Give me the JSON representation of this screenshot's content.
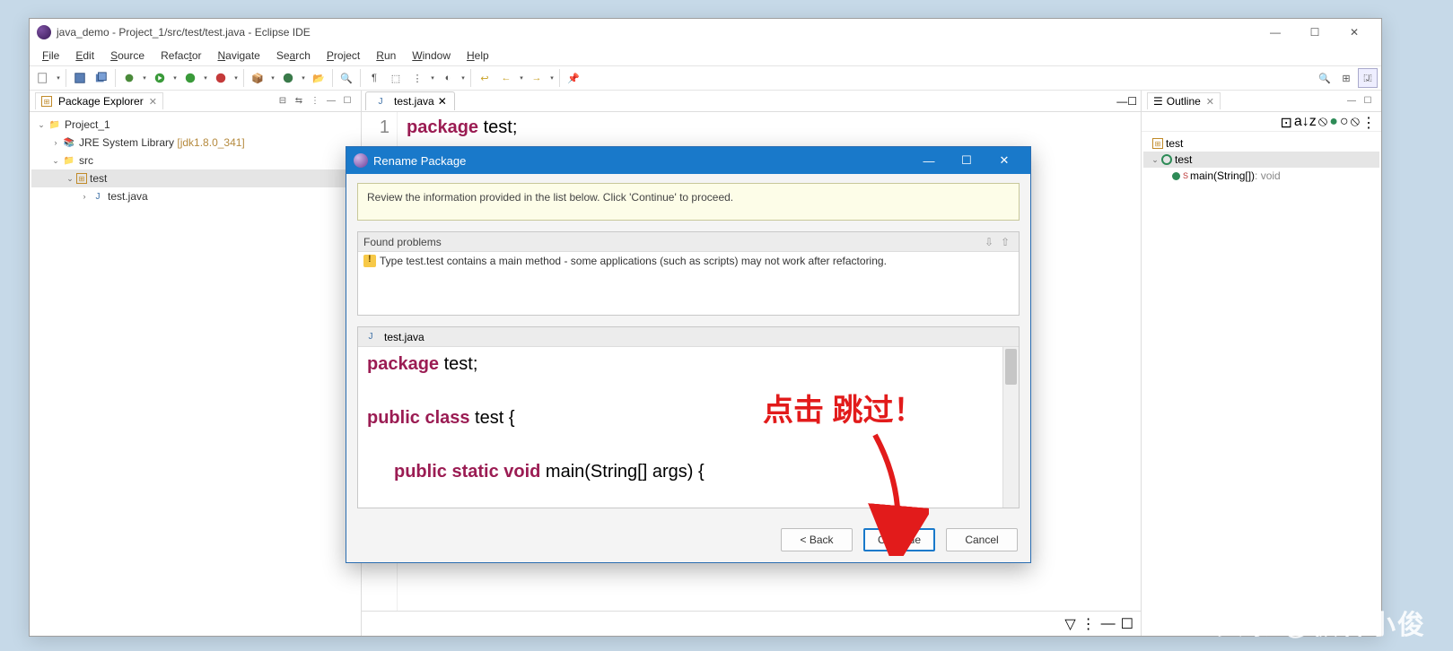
{
  "window": {
    "title": "java_demo - Project_1/src/test/test.java - Eclipse IDE"
  },
  "menu": {
    "file": "File",
    "edit": "Edit",
    "source": "Source",
    "refactor": "Refactor",
    "navigate": "Navigate",
    "search": "Search",
    "project": "Project",
    "run": "Run",
    "window": "Window",
    "help": "Help"
  },
  "package_explorer": {
    "title": "Package Explorer",
    "project": "Project_1",
    "jre": "JRE System Library",
    "jre_ver": "[jdk1.8.0_341]",
    "src": "src",
    "pkg": "test",
    "file": "test.java"
  },
  "editor": {
    "tab": "test.java",
    "line_no": "1",
    "kw_package": "package",
    "pkg_name": " test;"
  },
  "outline": {
    "title": "Outline",
    "pkg": "test",
    "cls": "test",
    "method": "main(String[]) : void",
    "method_name": "main(String[])",
    "method_ret": " : void"
  },
  "dialog": {
    "title": "Rename Package",
    "info": "Review the information provided in the list below. Click 'Continue' to proceed.",
    "found_problems": "Found problems",
    "warning": "Type test.test contains a main method - some applications (such as scripts) may not work after refactoring.",
    "preview_file": "test.java",
    "code": {
      "l1_kw": "package",
      "l1_rest": " test;",
      "l3_kw": "public class",
      "l3_rest": " test {",
      "l5_kw": "public static void",
      "l5_rest": " main(String[] args) {"
    },
    "buttons": {
      "back": "< Back",
      "continue": "Continue",
      "cancel": "Cancel"
    }
  },
  "annotation": "点击 跳过！",
  "watermark": "头条 @极客小俊"
}
